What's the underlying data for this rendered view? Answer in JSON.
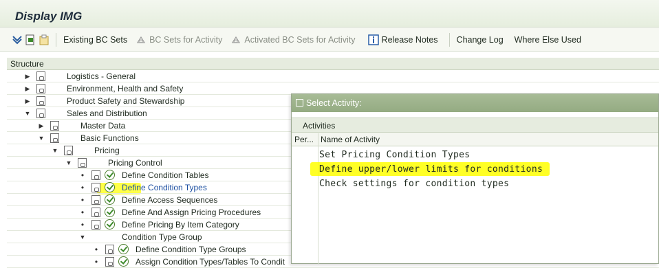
{
  "header": {
    "title": "Display IMG"
  },
  "toolbar": {
    "items": [
      {
        "label": "Existing BC Sets",
        "icon": "bc-set-icon"
      },
      {
        "label": "BC Sets for Activity",
        "icon": "bc-sets-activity-icon",
        "disabled": true
      },
      {
        "label": "Activated BC Sets for Activity",
        "icon": "activated-bc-sets-icon",
        "disabled": true
      },
      {
        "label": "Release Notes",
        "icon": "info-icon"
      },
      {
        "label": "Change Log"
      },
      {
        "label": "Where Else Used"
      }
    ]
  },
  "structure": {
    "header": "Structure",
    "rows": [
      {
        "label": "Logistics - General",
        "level": 0,
        "state": "collapsed",
        "exec": false
      },
      {
        "label": "Environment, Health and Safety",
        "level": 0,
        "state": "collapsed",
        "exec": false
      },
      {
        "label": "Product Safety and Stewardship",
        "level": 0,
        "state": "collapsed",
        "exec": false
      },
      {
        "label": "Sales and Distribution",
        "level": 0,
        "state": "expanded",
        "exec": false
      },
      {
        "label": "Master Data",
        "level": 1,
        "state": "collapsed",
        "exec": false
      },
      {
        "label": "Basic Functions",
        "level": 1,
        "state": "expanded",
        "exec": false
      },
      {
        "label": "Pricing",
        "level": 2,
        "state": "expanded",
        "exec": false
      },
      {
        "label": "Pricing Control",
        "level": 3,
        "state": "expanded",
        "exec": false
      },
      {
        "label": "Define Condition Tables",
        "level": 4,
        "state": "leaf",
        "exec": true
      },
      {
        "label": "Define Condition Types",
        "level": 4,
        "state": "leaf",
        "exec": true,
        "selected": true
      },
      {
        "label": "Define Access Sequences",
        "level": 4,
        "state": "leaf",
        "exec": true
      },
      {
        "label": "Define And Assign Pricing Procedures",
        "level": 4,
        "state": "leaf",
        "exec": true
      },
      {
        "label": "Define Pricing By Item Category",
        "level": 4,
        "state": "leaf",
        "exec": true
      },
      {
        "label": "Condition Type Group",
        "level": 4,
        "state": "expanded-nodoc",
        "exec": false
      },
      {
        "label": "Define Condition Type Groups",
        "level": 5,
        "state": "leaf",
        "exec": true
      },
      {
        "label": "Assign Condition Types/Tables To Condit",
        "level": 5,
        "state": "leaf",
        "exec": true
      }
    ]
  },
  "popup": {
    "title": "Select Activity:",
    "section": "Activities",
    "columns": [
      "Per...",
      "Name of Activity"
    ],
    "activities": [
      "Set Pricing Condition Types",
      "Define upper/lower limits for conditions",
      "Check settings for condition types"
    ]
  },
  "colors": {
    "highlight": "#ffff00",
    "popup_title": "#9fb58d",
    "link": "#1b4ea0"
  }
}
